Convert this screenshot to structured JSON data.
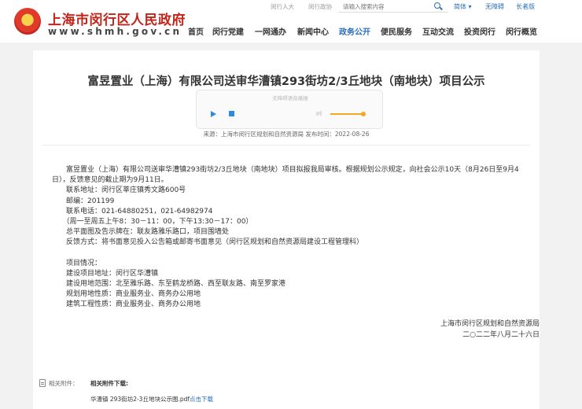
{
  "header": {
    "site_name": "上海市闵行区人民政府",
    "site_url": "www.shmh.gov.cn",
    "top_links": [
      "闵行人大",
      "闵行政协"
    ],
    "search_placeholder": "请输入搜索内容",
    "lang": "简体",
    "barrier_free": "无障碍",
    "elder_mode": "长者版",
    "nav": [
      "首页",
      "闵行党建",
      "一网通办",
      "新闻中心",
      "政务公开",
      "便民服务",
      "互动交流",
      "投资闵行",
      "闵行概览"
    ],
    "active_nav": "政务公开"
  },
  "article": {
    "title": "富昱置业（上海）有限公司送审华漕镇293街坊2/3丘地块（南地块）项目公示",
    "player_tip": "无障碍语音播报",
    "meta": "来源：上海市闵行区规划和自然资源局 发布时间：2022-08-26",
    "paragraphs": [
      "　　富昱置业（上海）有限公司送审华漕镇293街坊2/3丘地块（南地块）项目拟报我局审核。根据规划公示规定，向社会公示10天（8月26日至9月4日），反馈意见的截止期为9月11日。",
      "　　联系地址：闵行区莘庄镇秀文路600号",
      "　　邮编：201199",
      "　　联系电话：021-64880251，021-64982974",
      "　　（周一至周五上午8：30－11：00，下午13:30－17：00）",
      "　　总平面图及告示牌在：联友路雅乐路口，项目围墙处",
      "　　反馈方式：将书面意见投入公告箱或邮寄书面意见（闵行区规划和自然资源局建设工程管理科）"
    ],
    "project": [
      "　　项目情况：",
      "　　建设项目地址：闵行区华漕镇",
      "　　建设用地范围：北至雅乐路、东至鹤龙桥路、西至联友路、南至罗家港",
      "　　规划用地性质：商业服务业、商务办公用地",
      "　　建筑工程性质：商业服务业、商务办公用地"
    ],
    "signature_org": "上海市闵行区规划和自然资源局",
    "signature_date": "二○二二年八月二十六日",
    "attachments_label": "相关附件：",
    "download_heading": "相关附件下载:",
    "file_name": "华漕镇 293街坊2-3丘地块公示图.pdf",
    "download_link": "点击下载"
  },
  "colors": {
    "brand_red": "#c22419",
    "link_blue": "#2a6ebb",
    "player_accent": "#f5a623"
  }
}
